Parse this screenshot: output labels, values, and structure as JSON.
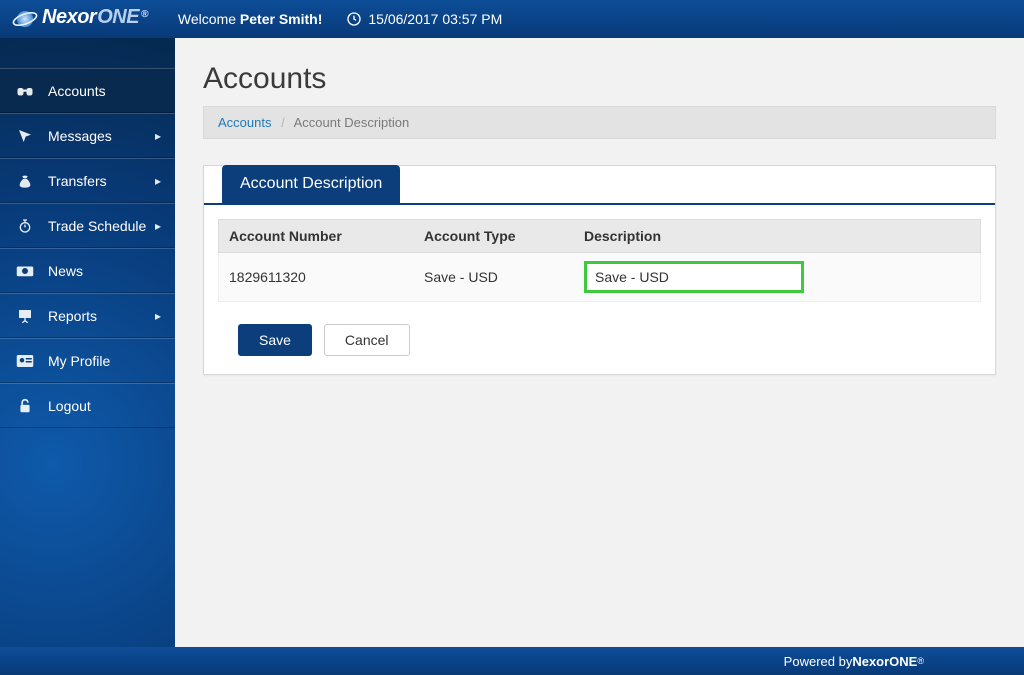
{
  "brand": {
    "name1": "Nexor",
    "name2": "ONE",
    "reg": "®"
  },
  "header": {
    "welcome_prefix": "Welcome ",
    "user_name": "Peter Smith!",
    "datetime": "15/06/2017 03:57 PM"
  },
  "sidebar": {
    "items": [
      {
        "label": "Accounts",
        "has_caret": false,
        "active": true
      },
      {
        "label": "Messages",
        "has_caret": true,
        "active": false
      },
      {
        "label": "Transfers",
        "has_caret": true,
        "active": false
      },
      {
        "label": "Trade Schedule",
        "has_caret": true,
        "active": false
      },
      {
        "label": "News",
        "has_caret": false,
        "active": false
      },
      {
        "label": "Reports",
        "has_caret": true,
        "active": false
      },
      {
        "label": "My Profile",
        "has_caret": false,
        "active": false
      },
      {
        "label": "Logout",
        "has_caret": false,
        "active": false
      }
    ]
  },
  "page": {
    "title": "Accounts",
    "crumb_root": "Accounts",
    "crumb_leaf": "Account Description",
    "tab_label": "Account Description",
    "columns": {
      "accnum": "Account Number",
      "acctype": "Account Type",
      "desc": "Description"
    },
    "row": {
      "accnum": "1829611320",
      "acctype": "Save - USD",
      "desc_value": "Save - USD"
    },
    "buttons": {
      "save": "Save",
      "cancel": "Cancel"
    }
  },
  "footer": {
    "text_prefix": "Powered by ",
    "brand": "NexorONE",
    "reg": "®"
  }
}
